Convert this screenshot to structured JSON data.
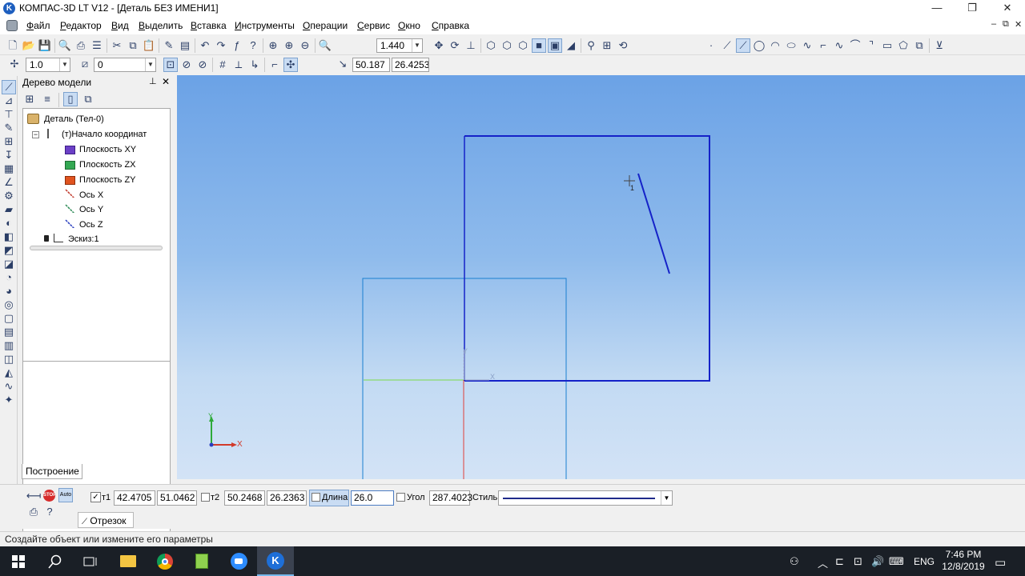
{
  "window": {
    "title": "КОМПАС-3D LT V12 - [Деталь БЕЗ ИМЕНИ1]",
    "app_icon_glyph": "K",
    "controls": {
      "minimize": "—",
      "maximize": "❐",
      "close": "✕"
    },
    "mdi_controls": {
      "minimize": "–",
      "restore": "⧉",
      "close": "✕"
    }
  },
  "menu": [
    "Файл",
    "Редактор",
    "Вид",
    "Выделить",
    "Вставка",
    "Инструменты",
    "Операции",
    "Сервис",
    "Окно",
    "Справка"
  ],
  "toolbar": {
    "zoom_value": "1.440",
    "step_value": "1.0",
    "layer_value": "0",
    "cursor_x": "50.187",
    "cursor_y": "26.4253"
  },
  "tree": {
    "title": "Дерево модели",
    "pin_glyph": "⊥",
    "close_glyph": "✕",
    "items": [
      {
        "label": "Деталь (Тел-0)",
        "icon": "part-icon"
      },
      {
        "label": "(т)Начало координат",
        "icon": "origin-icon"
      },
      {
        "label": "Плоскость XY",
        "icon": "plane-xy-icon",
        "color": "#6b3fc6"
      },
      {
        "label": "Плоскость ZX",
        "icon": "plane-zx-icon",
        "color": "#34a853"
      },
      {
        "label": "Плоскость ZY",
        "icon": "plane-zy-icon",
        "color": "#e0531f"
      },
      {
        "label": "Ось X",
        "icon": "axis-x-icon",
        "color": "#c0392b"
      },
      {
        "label": "Ось Y",
        "icon": "axis-y-icon",
        "color": "#2e8b57"
      },
      {
        "label": "Ось Z",
        "icon": "axis-z-icon",
        "color": "#2a3fbf"
      },
      {
        "label": "Эскиз:1",
        "icon": "sketch-icon"
      }
    ],
    "tab_label": "Построение"
  },
  "viewport": {
    "axis_x_label": "X",
    "axis_y_label": "Y",
    "origin_x_label": "X",
    "origin_y_label": "Y",
    "cursor_snap_label": "1",
    "colors": {
      "sketch": "#1522c8",
      "part_edge": "#1a7fd0",
      "axis_red": "#e0403a",
      "axis_green": "#7bd94a"
    }
  },
  "properties": {
    "t1_label": "т1",
    "t1_x": "42.4705",
    "t1_y": "51.0462",
    "t2_label": "т2",
    "t2_x": "50.2468",
    "t2_y": "26.2363",
    "length_label": "Длина",
    "length_value": "26.0",
    "angle_label": "Угол",
    "angle_value": "287.4023",
    "style_label": "Стиль",
    "object_tab": "Отрезок",
    "stop_label": "STOP",
    "auto_label": "Auto"
  },
  "status": {
    "text": "Создайте объект или измените его параметры"
  },
  "taskbar": {
    "lang": "ENG",
    "time": "7:46 PM",
    "date": "12/8/2019"
  }
}
